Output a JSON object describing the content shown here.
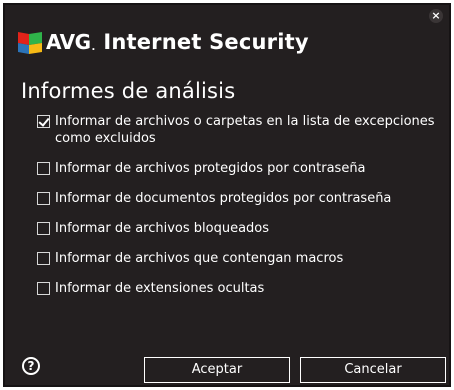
{
  "window": {
    "brand": "AVG",
    "brand_suffix": ".",
    "product": "Internet Security",
    "close_symbol": "×"
  },
  "section": {
    "title": "Informes de análisis"
  },
  "options": [
    {
      "label": "Informar de archivos o carpetas en la lista de excepciones como excluidos",
      "checked": true
    },
    {
      "label": "Informar de archivos protegidos por contraseña",
      "checked": false
    },
    {
      "label": "Informar de documentos protegidos por contraseña",
      "checked": false
    },
    {
      "label": "Informar de archivos bloqueados",
      "checked": false
    },
    {
      "label": "Informar de archivos que contengan macros",
      "checked": false
    },
    {
      "label": "Informar de extensiones ocultas",
      "checked": false
    }
  ],
  "footer": {
    "help_symbol": "?",
    "ok_label": "Aceptar",
    "cancel_label": "Cancelar"
  },
  "colors": {
    "background": "#231f20",
    "text": "#ffffff",
    "logo_red": "#e2231a",
    "logo_green": "#2fb34a",
    "logo_blue": "#2b73b8",
    "logo_yellow": "#f6b915"
  }
}
